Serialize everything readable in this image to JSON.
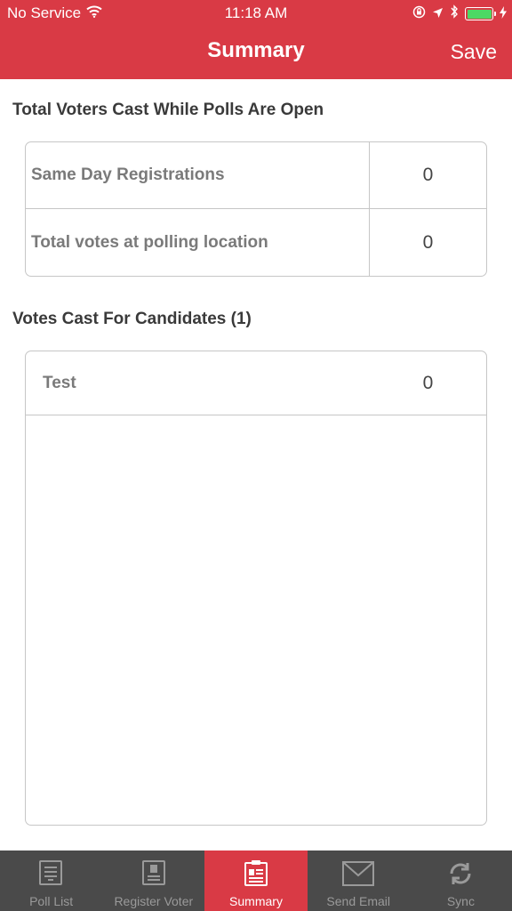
{
  "status_bar": {
    "carrier": "No Service",
    "time": "11:18 AM"
  },
  "nav": {
    "title": "Summary",
    "save_label": "Save"
  },
  "section1": {
    "heading": "Total Voters Cast While Polls Are Open",
    "rows": [
      {
        "label": "Same Day Registrations",
        "value": "0"
      },
      {
        "label": "Total votes at polling location",
        "value": "0"
      }
    ]
  },
  "section2": {
    "heading": "Votes Cast For Candidates (1)",
    "candidates": [
      {
        "name": "Test",
        "count": "0"
      }
    ]
  },
  "tabs": [
    {
      "label": "Poll List",
      "icon": "list-icon",
      "active": false
    },
    {
      "label": "Register Voter",
      "icon": "id-badge-icon",
      "active": false
    },
    {
      "label": "Summary",
      "icon": "clipboard-icon",
      "active": true
    },
    {
      "label": "Send Email",
      "icon": "envelope-icon",
      "active": false
    },
    {
      "label": "Sync",
      "icon": "sync-icon",
      "active": false
    }
  ],
  "colors": {
    "accent": "#d93a45",
    "tabbar": "#4a4a4a",
    "battery": "#4cd964"
  }
}
